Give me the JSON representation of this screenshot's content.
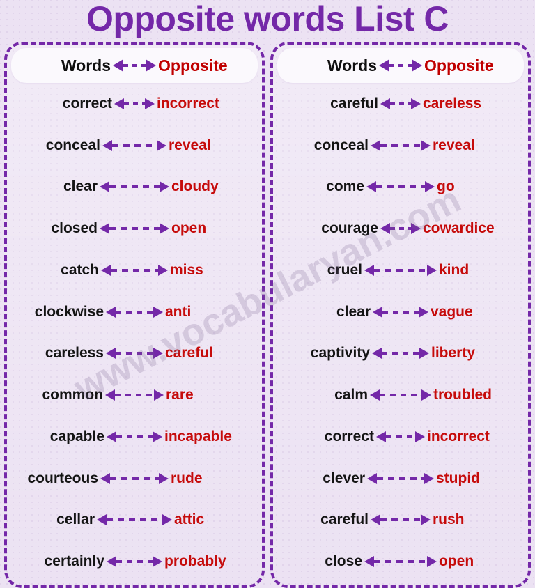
{
  "title": "Opposite words List C",
  "watermark": "www.vocabularyan.com",
  "colors": {
    "purple": "#7428a8",
    "red": "#c60b0b",
    "black": "#141414",
    "background": "#ece2f3",
    "header_background": "#fbf9fd"
  },
  "header": {
    "words_label": "Words",
    "arrow": "double-arrow",
    "opposite_label": "Opposite"
  },
  "columns": [
    {
      "id": "left",
      "header": {
        "words_label": "Words",
        "opposite_label": "Opposite"
      },
      "rows": [
        {
          "word": "correct",
          "opposite": "incorrect",
          "arrow_len": "short"
        },
        {
          "word": "conceal",
          "opposite": "reveal",
          "arrow_len": "long"
        },
        {
          "word": "clear",
          "opposite": "cloudy",
          "arrow_len": "long"
        },
        {
          "word": "closed",
          "opposite": "open",
          "arrow_len": "long"
        },
        {
          "word": "catch",
          "opposite": "miss",
          "arrow_len": "long"
        },
        {
          "word": "clockwise",
          "opposite": "anti",
          "arrow_len": "medium"
        },
        {
          "word": "careless",
          "opposite": "careful",
          "arrow_len": "medium"
        },
        {
          "word": "common",
          "opposite": "rare",
          "arrow_len": "medium"
        },
        {
          "word": "capable",
          "opposite": "incapable",
          "arrow_len": "medium"
        },
        {
          "word": "courteous",
          "opposite": "rude",
          "arrow_len": "long"
        },
        {
          "word": "cellar",
          "opposite": "attic",
          "arrow_len": "long"
        },
        {
          "word": "certainly",
          "opposite": "probably",
          "arrow_len": "medium"
        }
      ]
    },
    {
      "id": "right",
      "header": {
        "words_label": "Words",
        "opposite_label": "Opposite"
      },
      "rows": [
        {
          "word": "careful",
          "opposite": "careless",
          "arrow_len": "short"
        },
        {
          "word": "conceal",
          "opposite": "reveal",
          "arrow_len": "medium"
        },
        {
          "word": "come",
          "opposite": "go",
          "arrow_len": "long"
        },
        {
          "word": "courage",
          "opposite": "cowardice",
          "arrow_len": "short"
        },
        {
          "word": "cruel",
          "opposite": "kind",
          "arrow_len": "long"
        },
        {
          "word": "clear",
          "opposite": "vague",
          "arrow_len": "medium"
        },
        {
          "word": "captivity",
          "opposite": "liberty",
          "arrow_len": "medium"
        },
        {
          "word": "calm",
          "opposite": "troubled",
          "arrow_len": "medium"
        },
        {
          "word": "correct",
          "opposite": "incorrect",
          "arrow_len": "short"
        },
        {
          "word": "clever",
          "opposite": "stupid",
          "arrow_len": "long"
        },
        {
          "word": "careful",
          "opposite": "rush",
          "arrow_len": "medium"
        },
        {
          "word": "close",
          "opposite": "open",
          "arrow_len": "long"
        }
      ]
    }
  ]
}
